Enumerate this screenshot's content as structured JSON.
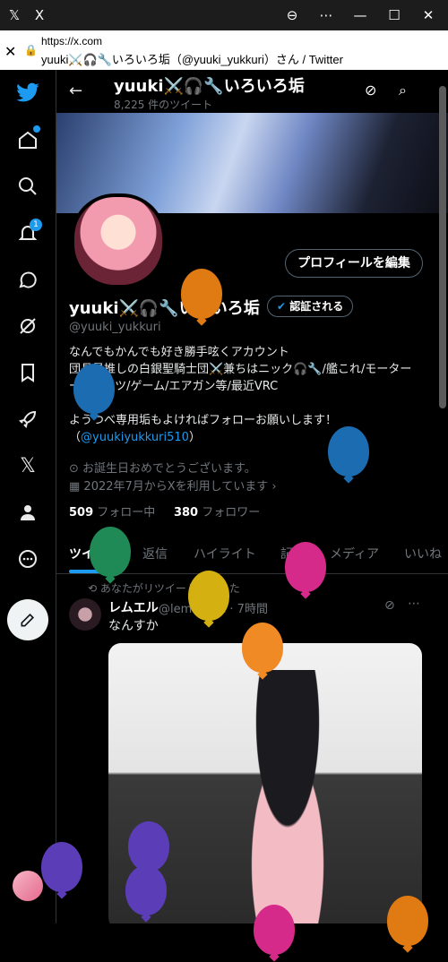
{
  "window": {
    "title_icon": "x-logo",
    "app_letter": "X"
  },
  "urlbar": {
    "url": "https://x.com",
    "title": "yuuki⚔️🎧🔧いろいろ垢（@yuuki_yukkuri）さん / Twitter"
  },
  "sidebar": {
    "notification_count": "1"
  },
  "header": {
    "name": "yuuki⚔️🎧🔧いろいろ垢",
    "tweet_count": "8,225 件のツイート"
  },
  "profile": {
    "edit_button": "プロフィールを編集",
    "name": "yuuki⚔️🎧🔧いろいろ垢",
    "verified_label": "認証される",
    "handle": "@yuuki_yukkuri",
    "bio_lines": [
      "なんでもかんでも好き勝手呟くアカウント",
      "団長最推しの白銀聖騎士団⚔️兼ちはニック🎧🔧/艦これ/モーター",
      "ースポーツ/ゲーム/エアガン等/最近VRC",
      "",
      "ようつべ専用垢もよければフォローお願いします！"
    ],
    "bio_link": "@yuukiyukkuri510",
    "birthday": "お誕生日おめでとうございます。",
    "joined": "2022年7月からXを利用しています",
    "following_count": "509",
    "following_label": "フォロー中",
    "followers_count": "380",
    "followers_label": "フォロワー"
  },
  "tabs": [
    "ツイート",
    "返信",
    "ハイライト",
    "記事",
    "メディア",
    "いいね"
  ],
  "tweet": {
    "retweet_label": "あなたがリツイートしました",
    "author": "レムエル",
    "handle": "@lemel_vrc · 7時間",
    "text": "なんすか"
  },
  "colors": {
    "accent": "#1d9bf0",
    "background": "#000000"
  },
  "balloons": [
    "#e07a12",
    "#1b6cb0",
    "#1b6cb0",
    "#d4b010",
    "#1f8a55",
    "#d62a8a",
    "#f08a24",
    "#5b3db8",
    "#5b3db8",
    "#5b3db8",
    "#e07a12",
    "#d62a8a"
  ]
}
